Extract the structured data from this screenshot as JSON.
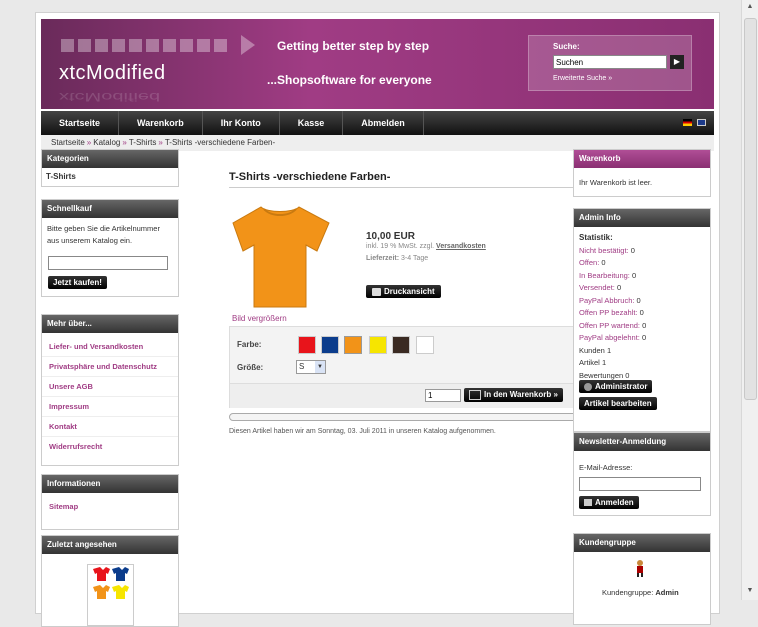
{
  "header": {
    "logo": "xtcModified",
    "tagline1": "Getting better step by step",
    "tagline2": "...Shopsoftware for everyone",
    "search_label": "Suche:",
    "search_value": "Suchen",
    "search_advanced": "Erweiterte Suche »"
  },
  "nav": [
    "Startseite",
    "Warenkorb",
    "Ihr Konto",
    "Kasse",
    "Abmelden"
  ],
  "breadcrumb": [
    "Startseite",
    "Katalog",
    "T-Shirts",
    "T-Shirts -verschiedene Farben-"
  ],
  "left": {
    "categories": {
      "title": "Kategorien",
      "item": "T-Shirts"
    },
    "quickbuy": {
      "title": "Schnellkauf",
      "text": "Bitte geben Sie die Artikelnummer aus unserem Katalog ein.",
      "button": "Jetzt kaufen!"
    },
    "more": {
      "title": "Mehr über...",
      "links": [
        "Liefer- und Versandkosten",
        "Privatsphäre und Datenschutz",
        "Unsere AGB",
        "Impressum",
        "Kontakt",
        "Widerrufsrecht"
      ]
    },
    "info": {
      "title": "Informationen",
      "link": "Sitemap"
    },
    "recent": {
      "title": "Zuletzt angesehen"
    }
  },
  "product": {
    "title": "T-Shirts -verschiedene Farben-",
    "price": "10,00 EUR",
    "tax": "inkl. 19 % MwSt. zzgl.",
    "shipping_link": "Versandkosten",
    "delivery_label": "Lieferzeit:",
    "delivery_value": "3-4 Tage",
    "print_button": "Druckansicht",
    "enlarge": "Bild vergrößern",
    "color_label": "Farbe:",
    "size_label": "Größe:",
    "size_value": "S",
    "quantity": "1",
    "cart_button": "In den Warenkorb »",
    "note": "Diesen Artikel haben wir am Sonntag, 03. Juli 2011 in unseren Katalog aufgenommen.",
    "colors": [
      "#e8141b",
      "#0b3c8c",
      "#f29318",
      "#f6e500",
      "#3a2a22",
      "#ffffff"
    ]
  },
  "right": {
    "cart": {
      "title": "Warenkorb",
      "text": "Ihr Warenkorb ist leer."
    },
    "admin": {
      "title": "Admin Info",
      "stat_title": "Statistik:",
      "stats": [
        {
          "label": "Nicht bestätigt:",
          "value": "0",
          "link": true
        },
        {
          "label": "Offen:",
          "value": "0",
          "link": true
        },
        {
          "label": "In Bearbeitung:",
          "value": "0",
          "link": true
        },
        {
          "label": "Versendet:",
          "value": "0",
          "link": true
        },
        {
          "label": "PayPal Abbruch:",
          "value": "0",
          "link": true
        },
        {
          "label": "Offen PP bezahlt:",
          "value": "0",
          "link": true
        },
        {
          "label": "Offen PP wartend:",
          "value": "0",
          "link": true
        },
        {
          "label": "PayPal abgelehnt:",
          "value": "0",
          "link": true
        },
        {
          "label": "Kunden",
          "value": "1",
          "link": false
        },
        {
          "label": "Artikel",
          "value": "1",
          "link": false
        },
        {
          "label": "Bewertungen",
          "value": "0",
          "link": false
        }
      ],
      "btn_admin": "Administrator",
      "btn_edit": "Artikel bearbeiten"
    },
    "newsletter": {
      "title": "Newsletter-Anmeldung",
      "label": "E-Mail-Adresse:",
      "button": "Anmelden"
    },
    "group": {
      "title": "Kundengruppe",
      "label": "Kundengruppe:",
      "value": "Admin"
    }
  }
}
